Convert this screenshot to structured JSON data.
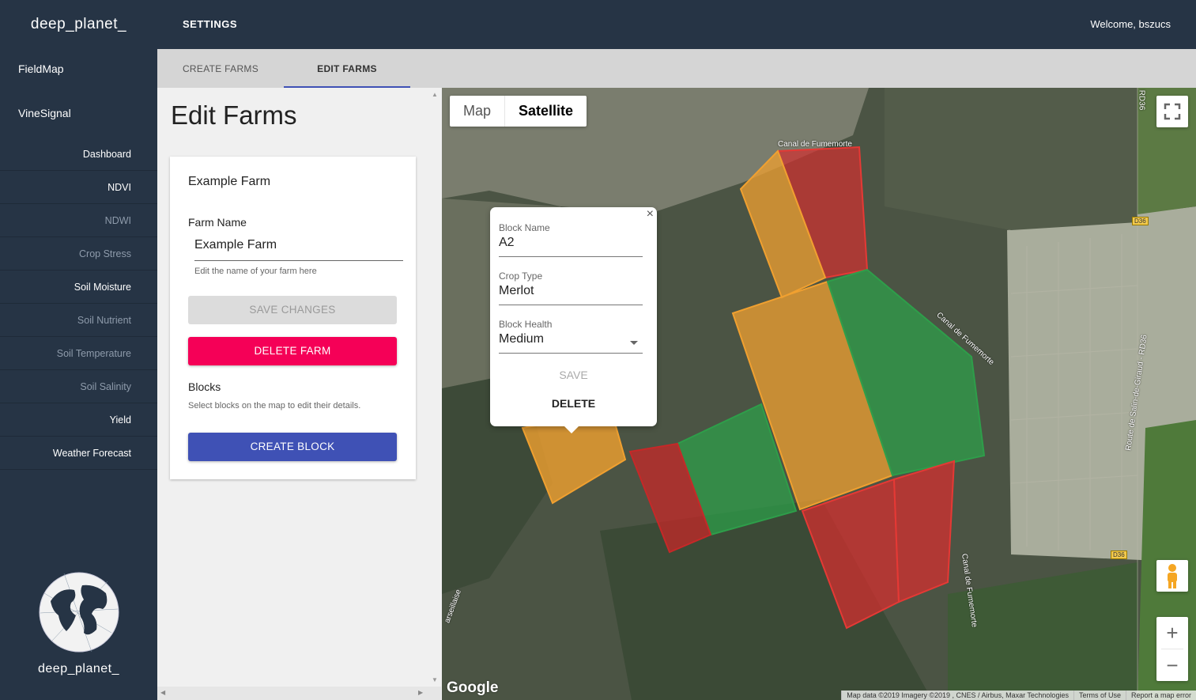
{
  "brand": "deep_planet_",
  "header": {
    "title": "SETTINGS",
    "welcome": "Welcome, bszucs"
  },
  "sidebar": {
    "top_items": [
      "FieldMap",
      "VineSignal"
    ],
    "sub_items": [
      {
        "label": "Dashboard",
        "dim": false
      },
      {
        "label": "NDVI",
        "dim": false
      },
      {
        "label": "NDWI",
        "dim": true
      },
      {
        "label": "Crop Stress",
        "dim": true
      },
      {
        "label": "Soil Moisture",
        "dim": false
      },
      {
        "label": "Soil Nutrient",
        "dim": true
      },
      {
        "label": "Soil Temperature",
        "dim": true
      },
      {
        "label": "Soil Salinity",
        "dim": true
      },
      {
        "label": "Yield",
        "dim": false
      },
      {
        "label": "Weather Forecast",
        "dim": false
      }
    ],
    "logo_text": "deep_planet_"
  },
  "tabs": [
    {
      "label": "CREATE FARMS",
      "active": false
    },
    {
      "label": "EDIT FARMS",
      "active": true
    }
  ],
  "panel": {
    "heading": "Edit Farms",
    "farm_card_title": "Example Farm",
    "farm_name_label": "Farm Name",
    "farm_name_value": "Example Farm",
    "farm_name_helper": "Edit the name of your farm here",
    "save_label": "SAVE CHANGES",
    "delete_label": "DELETE FARM",
    "blocks_label": "Blocks",
    "blocks_helper": "Select blocks on the map to edit their details.",
    "create_block_label": "CREATE BLOCK"
  },
  "map": {
    "type_map": "Map",
    "type_satellite": "Satellite",
    "google": "Google",
    "attribution": [
      "Map data ©2019 Imagery ©2019 , CNES / Airbus, Maxar Technologies",
      "Terms of Use",
      "Report a map error"
    ],
    "labels": {
      "canal_top": "Canal de Fumemorte",
      "canal_mid": "Canal de Fumemorte",
      "canal_bottom": "Canal de Fumemorte",
      "route": "Route de Salin-de-Giraud - RD36",
      "rd36": "RD36",
      "d36a": "D36",
      "d36b": "D36",
      "marseillaise": "arseillaise"
    },
    "zoom_in": "+",
    "zoom_out": "−",
    "colors": {
      "healthy": "#2e9e4a",
      "medium": "#f0a030",
      "poor": "#d32f2f"
    }
  },
  "popup": {
    "block_name_label": "Block Name",
    "block_name_value": "A2",
    "crop_type_label": "Crop Type",
    "crop_type_value": "Merlot",
    "block_health_label": "Block Health",
    "block_health_value": "Medium",
    "save_label": "SAVE",
    "delete_label": "DELETE",
    "close": "×"
  }
}
